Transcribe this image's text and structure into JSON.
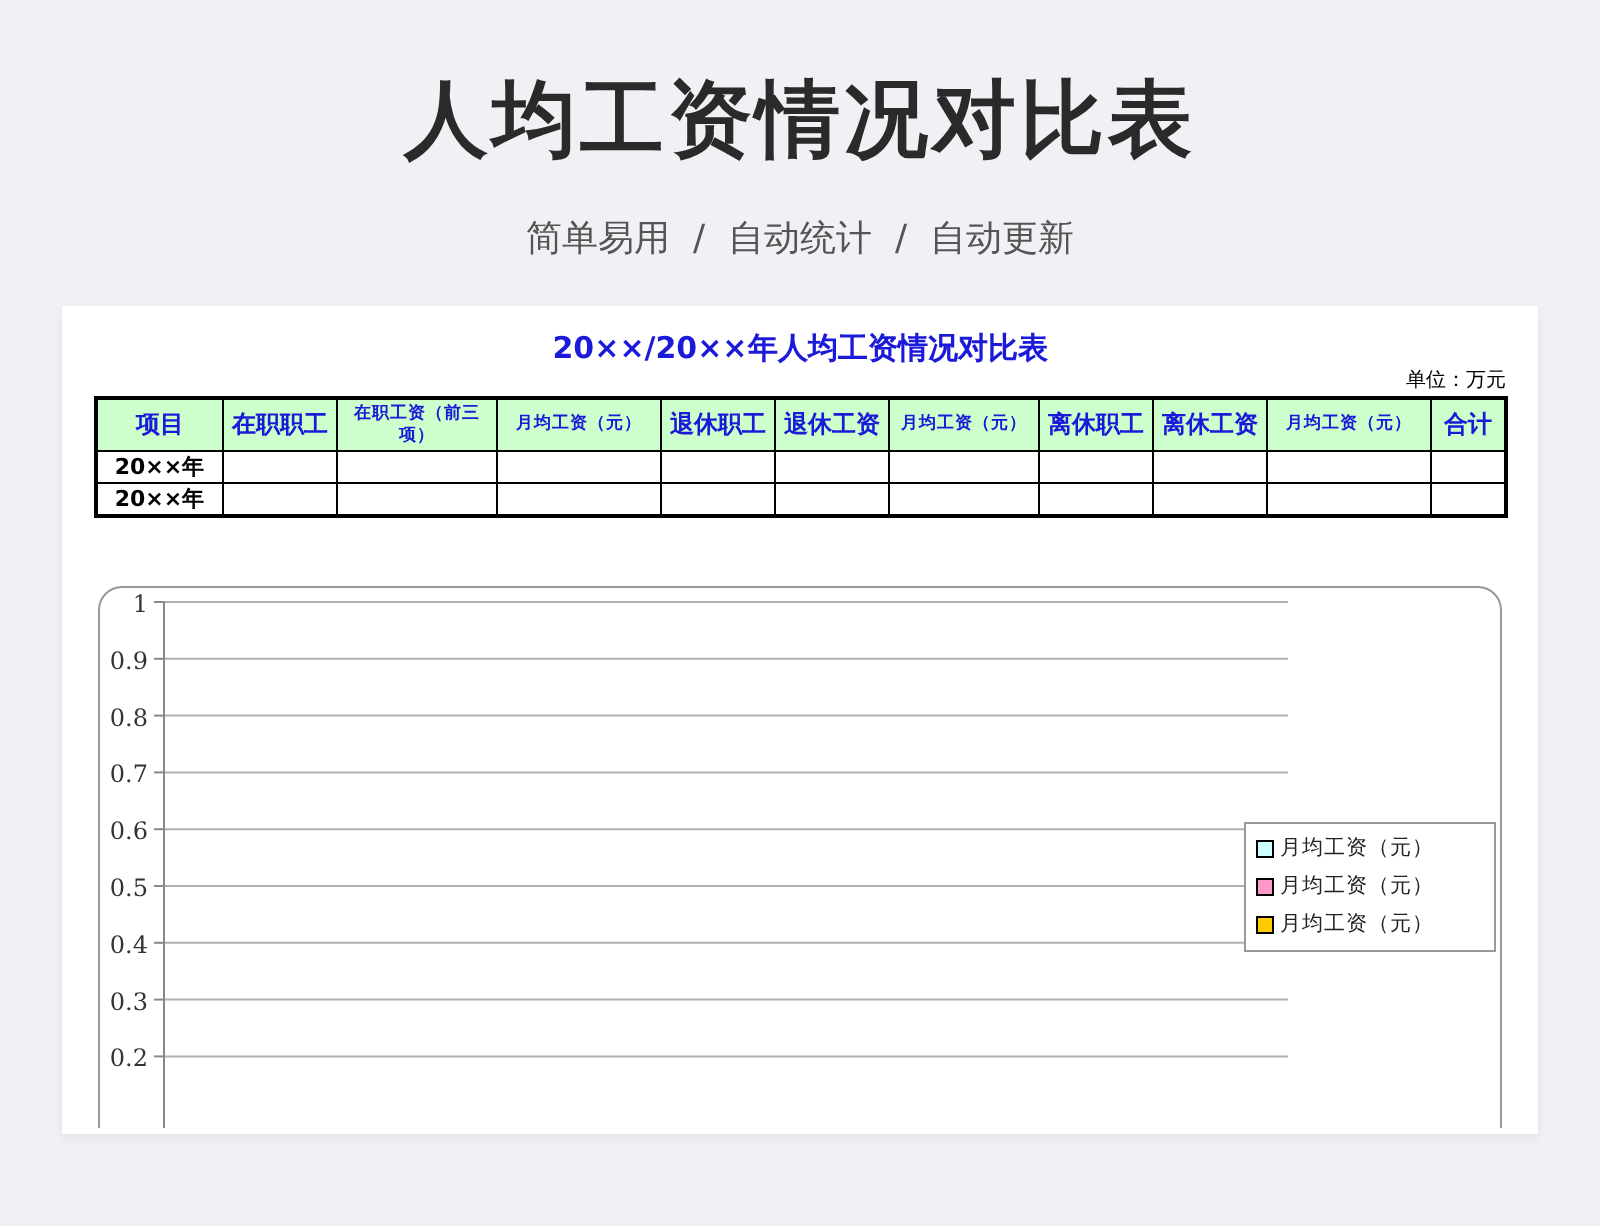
{
  "page": {
    "title": "人均工资情况对比表",
    "subtitle": "简单易用  /  自动统计  /  自动更新"
  },
  "sheet": {
    "title": "20××/20××年人均工资情况对比表",
    "unit": "单位：万元",
    "table": {
      "columns": [
        {
          "label": "项目",
          "kind": "normal"
        },
        {
          "label": "在职职工",
          "kind": "normal"
        },
        {
          "label": "在职工资（前三项）",
          "kind": "small"
        },
        {
          "label": "月均工资（元）",
          "kind": "small"
        },
        {
          "label": "退休职工",
          "kind": "normal"
        },
        {
          "label": "退休工资",
          "kind": "normal"
        },
        {
          "label": "月均工资（元）",
          "kind": "small"
        },
        {
          "label": "离休职工",
          "kind": "normal"
        },
        {
          "label": "离休工资",
          "kind": "normal"
        },
        {
          "label": "月均工资（元）",
          "kind": "small"
        },
        {
          "label": "合计",
          "kind": "normal"
        }
      ],
      "rows": [
        {
          "label": "20××年"
        },
        {
          "label": "20××年"
        }
      ]
    },
    "chart_data": {
      "type": "bar",
      "grid": true,
      "ylim": [
        0,
        1
      ],
      "yticks": [
        1,
        0.9,
        0.8,
        0.7,
        0.6,
        0.5,
        0.4,
        0.3,
        0.2
      ],
      "series": [
        {
          "name": "月均工资（元）",
          "color": "#ccffff"
        },
        {
          "name": "月均工资（元）",
          "color": "#ff99cc"
        },
        {
          "name": "月均工资（元）",
          "color": "#ffcc00"
        }
      ]
    }
  }
}
